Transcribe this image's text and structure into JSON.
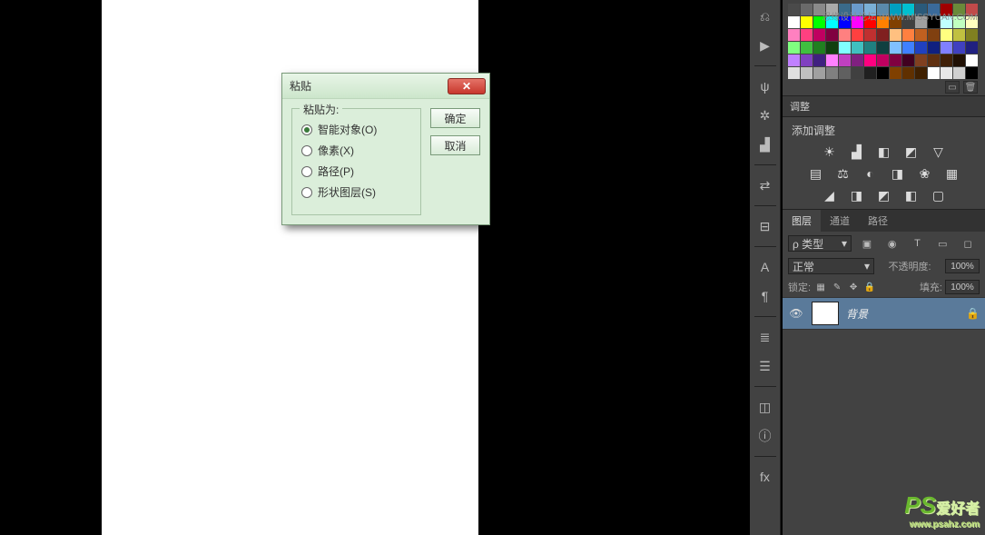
{
  "dialog": {
    "title": "粘贴",
    "legend": "粘贴为:",
    "options": [
      "智能对象(O)",
      "像素(X)",
      "路径(P)",
      "形状图层(S)"
    ],
    "selected": 0,
    "ok": "确定",
    "cancel": "取消"
  },
  "toolstrip": [
    {
      "name": "history-icon",
      "glyph": "⎌"
    },
    {
      "name": "play-icon",
      "glyph": "▶"
    },
    {
      "sep": true
    },
    {
      "name": "brush-preset-icon",
      "glyph": "ψ"
    },
    {
      "name": "wheel-icon",
      "glyph": "✲"
    },
    {
      "name": "histogram-icon",
      "glyph": "▟"
    },
    {
      "sep": true
    },
    {
      "name": "swap-icon",
      "glyph": "⇄"
    },
    {
      "sep": true
    },
    {
      "name": "ruler-icon",
      "glyph": "⊟"
    },
    {
      "sep": true
    },
    {
      "name": "text-icon",
      "glyph": "A"
    },
    {
      "name": "paragraph-icon",
      "glyph": "¶"
    },
    {
      "sep": true
    },
    {
      "name": "align-icon",
      "glyph": "≣"
    },
    {
      "name": "list-icon",
      "glyph": "☰"
    },
    {
      "sep": true
    },
    {
      "name": "measure-icon",
      "glyph": "◫"
    },
    {
      "name": "info-icon",
      "glyph": "ⓘ"
    },
    {
      "sep": true
    },
    {
      "name": "fx-icon",
      "glyph": "fx"
    }
  ],
  "swatches": [
    "#4a4a4a",
    "#6a6a6a",
    "#8a8a8a",
    "#aaaaaa",
    "#3a6a8a",
    "#6a9acb",
    "#7ab0d6",
    "#5a8aab",
    "#00a0c0",
    "#00c0d0",
    "#2a5a7a",
    "#3a6a9a",
    "#a00000",
    "#6a8a3a",
    "#c04a4a",
    "#ffffff",
    "#ffff00",
    "#00ff00",
    "#00ffff",
    "#0000ff",
    "#ff00ff",
    "#ff0000",
    "#ff8000",
    "#804000",
    "#404040",
    "#a0a0a0",
    "#000000",
    "#c0ffff",
    "#c0ffc0",
    "#ffffc0",
    "#ff80c0",
    "#ff4080",
    "#c00060",
    "#800040",
    "#ff8080",
    "#ff4040",
    "#c03030",
    "#802020",
    "#ffc080",
    "#ff8040",
    "#c06020",
    "#804010",
    "#ffff80",
    "#c0c040",
    "#808020",
    "#80ff80",
    "#40c040",
    "#208020",
    "#104010",
    "#80ffff",
    "#40c0c0",
    "#208080",
    "#104040",
    "#80c0ff",
    "#4080ff",
    "#2040c0",
    "#102080",
    "#8080ff",
    "#4040c0",
    "#202080",
    "#c080ff",
    "#8040c0",
    "#402080",
    "#ff80ff",
    "#c040c0",
    "#802080",
    "#ff0080",
    "#c00060",
    "#800040",
    "#400020",
    "#804020",
    "#603010",
    "#402008",
    "#201004",
    "#ffffff",
    "#e0e0e0",
    "#c0c0c0",
    "#a0a0a0",
    "#808080",
    "#606060",
    "#404040",
    "#202020",
    "#000000",
    "#804000",
    "#603000",
    "#402000",
    "#ffffff",
    "#e8e8e8",
    "#d0d0d0",
    "#000000"
  ],
  "adjustments": {
    "tab": "调整",
    "label": "添加调整",
    "rows": [
      [
        "☀",
        "▟",
        "◧",
        "◩",
        "▽"
      ],
      [
        "▤",
        "⚖",
        "◐",
        "◨",
        "❀",
        "▦"
      ],
      [
        "◢",
        "◨",
        "◩",
        "◧",
        "▢"
      ]
    ]
  },
  "layers": {
    "tabs": [
      "图层",
      "通道",
      "路径"
    ],
    "activeTab": 0,
    "filterLabel": "类型",
    "filterIcons": [
      "▣",
      "◉",
      "T",
      "▭",
      "◻"
    ],
    "blendMode": "正常",
    "opacityLabel": "不透明度:",
    "opacity": "100%",
    "lockLabel": "锁定:",
    "lockIcons": [
      "▦",
      "✎",
      "✥",
      "🔒"
    ],
    "fillLabel": "填充:",
    "fill": "100%",
    "items": [
      {
        "name": "背景",
        "locked": true
      }
    ]
  },
  "watermarks": {
    "topRight": "思缘设计论坛 WWW.MISSYUAN.COM",
    "logoBig": "PS",
    "logoCn": "爱好者",
    "logoUrl": "www.psahz.com"
  }
}
